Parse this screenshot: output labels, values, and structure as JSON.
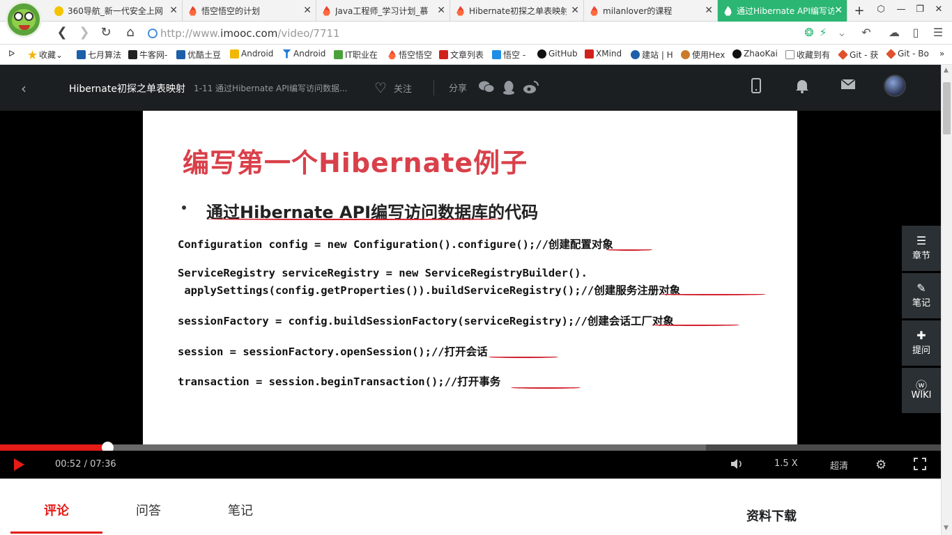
{
  "browser": {
    "tabs": [
      {
        "label": "360导航_新一代安全上网"
      },
      {
        "label": "悟空悟空的计划"
      },
      {
        "label": "Java工程师_学习计划_慕"
      },
      {
        "label": "Hibernate初探之单表映射"
      },
      {
        "label": "milanlover的课程"
      },
      {
        "label": "通过Hibernate API编写访"
      }
    ],
    "address": {
      "scheme": "http://www.",
      "host": "imooc.com",
      "path": "/video/7711"
    },
    "bookmarks": [
      {
        "label": "收藏",
        "color": "#f5b400"
      },
      {
        "label": "七月算法",
        "color": "#1d5fa8"
      },
      {
        "label": "牛客网-",
        "color": "#222222"
      },
      {
        "label": "优酷土豆",
        "color": "#1d5fa8"
      },
      {
        "label": "Android",
        "color": "#f2b705"
      },
      {
        "label": "Android",
        "color": "#1d7ad6"
      },
      {
        "label": "IT职业在",
        "color": "#4aa13b"
      },
      {
        "label": "悟空悟空",
        "color": "#e8452c"
      },
      {
        "label": "文章列表",
        "color": "#d0211c"
      },
      {
        "label": "悟空 -",
        "color": "#1e8ee6"
      },
      {
        "label": "GitHub",
        "color": "#111111"
      },
      {
        "label": "XMind",
        "color": "#d0211c"
      },
      {
        "label": "建站 | H",
        "color": "#1d5fa8"
      },
      {
        "label": "使用Hex",
        "color": "#c97a2b"
      },
      {
        "label": "ZhaoKai",
        "color": "#111111"
      },
      {
        "label": "收藏到有",
        "color": "#888888"
      },
      {
        "label": "Git - 获",
        "color": "#e0512c"
      },
      {
        "label": "Git - Bo",
        "color": "#e0512c"
      }
    ]
  },
  "header": {
    "course_title": "Hibernate初探之单表映射",
    "chapter_title": "1-11 通过Hibernate API编写访问数据...",
    "follow_label": "关注",
    "share_label": "分享"
  },
  "slide": {
    "title": "编写第一个Hibernate例子",
    "bullet": "通过Hibernate API编写访问数据库的代码",
    "code_lines": [
      "Configuration config = new Configuration().configure();//创建配置对象",
      "ServiceRegistry serviceRegistry = new ServiceRegistryBuilder().",
      " applySettings(config.getProperties()).buildServiceRegistry();//创建服务注册对象",
      "sessionFactory = config.buildSessionFactory(serviceRegistry);//创建会话工厂对象",
      "session = sessionFactory.openSession();//打开会话",
      "transaction = session.beginTransaction();//打开事务"
    ]
  },
  "side_panel": [
    {
      "label": "章节",
      "icon": "list-icon"
    },
    {
      "label": "笔记",
      "icon": "pencil-icon"
    },
    {
      "label": "提问",
      "icon": "question-icon"
    },
    {
      "label": "WIKI",
      "icon": "wiki-icon"
    }
  ],
  "player": {
    "current_time": "00:52",
    "separator": "/",
    "duration": "07:36",
    "played_fraction": 0.114,
    "buffered_fraction": 0.75,
    "speed": "1.5 X",
    "quality": "超清",
    "accent_color": "#e41b17"
  },
  "content_tabs": [
    {
      "label": "评论"
    },
    {
      "label": "问答"
    },
    {
      "label": "笔记"
    }
  ],
  "resources_title": "资料下载"
}
